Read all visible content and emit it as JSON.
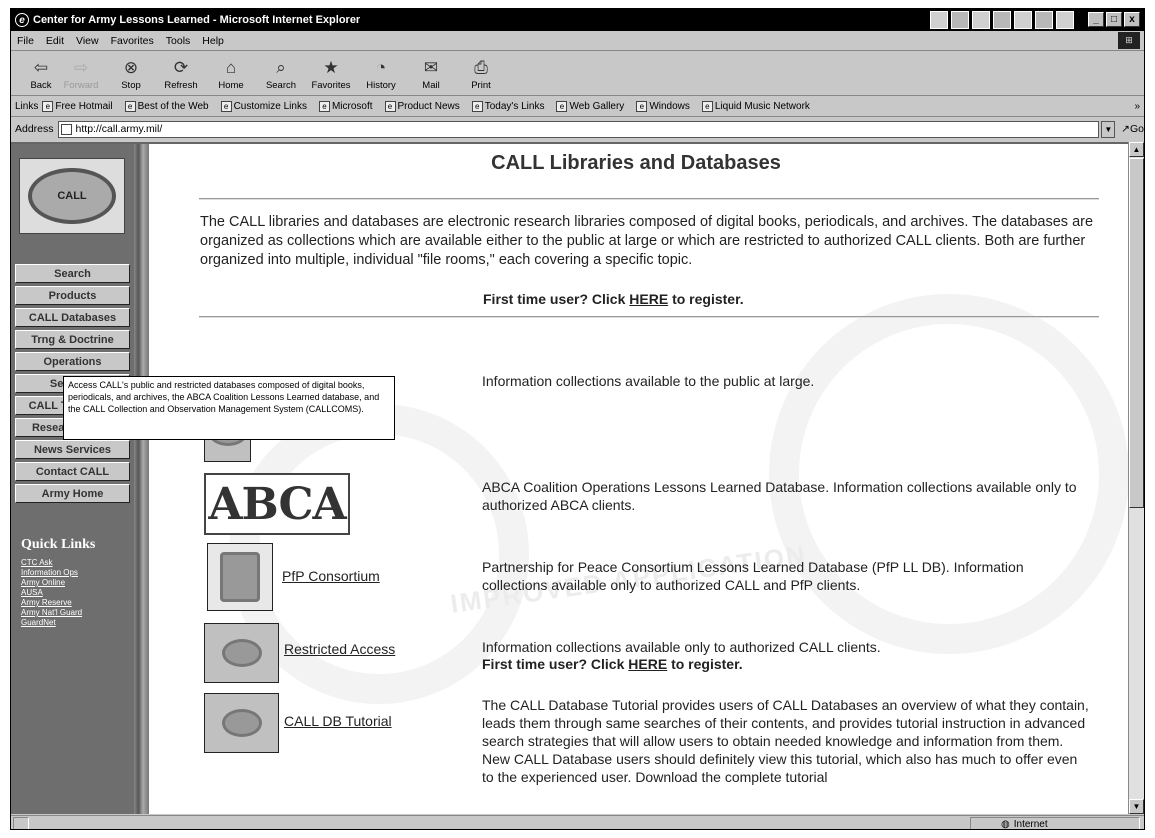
{
  "window": {
    "title": "Center for Army Lessons Learned - Microsoft Internet Explorer",
    "buttons": [
      "_",
      "□",
      "x"
    ]
  },
  "menu": [
    "File",
    "Edit",
    "View",
    "Favorites",
    "Tools",
    "Help"
  ],
  "toolbar": [
    {
      "label": "Back",
      "icon": "⇦",
      "disabled": false
    },
    {
      "label": "Forward",
      "icon": "⇨",
      "disabled": true
    },
    {
      "label": "Stop",
      "icon": "⊗",
      "disabled": false
    },
    {
      "label": "Refresh",
      "icon": "⟳",
      "disabled": false
    },
    {
      "label": "Home",
      "icon": "⌂",
      "disabled": false
    },
    {
      "label": "Search",
      "icon": "⌕",
      "disabled": false
    },
    {
      "label": "Favorites",
      "icon": "★",
      "disabled": false
    },
    {
      "label": "History",
      "icon": "◔",
      "disabled": false
    },
    {
      "label": "Mail",
      "icon": "✉",
      "disabled": false
    },
    {
      "label": "Print",
      "icon": "⎙",
      "disabled": false
    }
  ],
  "links_bar": {
    "label": "Links",
    "items": [
      "Free Hotmail",
      "Best of the Web",
      "Customize Links",
      "Microsoft",
      "Product News",
      "Today's Links",
      "Web Gallery",
      "Windows",
      "Liquid Music Network"
    ],
    "more": "»"
  },
  "address": {
    "label": "Address",
    "url": "http://call.army.mil/",
    "go": "Go"
  },
  "logo": {
    "text": "CALL"
  },
  "nav": [
    "Search",
    "Products",
    "CALL Databases",
    "Trng & Doctrine",
    "Operations",
    "Services",
    "CALL Thesaurus",
    "Research Tools",
    "News Services",
    "Contact CALL",
    "Army Home"
  ],
  "quick_links": {
    "title": "Quick Links",
    "items": [
      "CTC Ask",
      "Information Ops",
      "Army Online",
      "AUSA",
      "Army Reserve",
      "Army Nat'l Guard",
      "GuardNet"
    ]
  },
  "tooltip": "Access CALL's public and restricted databases composed of digital books, periodicals, and archives, the ABCA Coalition Lessons Learned database, and the CALL Collection and Observation Management System (CALLCOMS).",
  "page": {
    "title": "CALL Libraries and Databases",
    "intro": "The CALL libraries and databases are electronic research libraries composed of digital books, periodicals, and archives. The databases are organized as collections which are available either to the public at large or which are restricted to authorized CALL clients. Both are further organized into multiple, individual \"file rooms,\" each covering a specific topic.",
    "register_prefix": "First time user? Click ",
    "register_link": "HERE",
    "register_suffix": " to register.",
    "watermark": "IMPROVED APPLICATION",
    "entries": [
      {
        "link": "",
        "desc": "Information collections available to the public at large."
      },
      {
        "link": "",
        "image_text": "ABCA",
        "desc": "ABCA Coalition Operations Lessons Learned Database. Information collections available only to authorized ABCA clients."
      },
      {
        "link": "PfP Consortium",
        "desc": "Partnership for Peace Consortium Lessons Learned Database (PfP LL DB). Information collections available only to authorized CALL and PfP clients."
      },
      {
        "link": "Restricted Access",
        "desc": "Information collections available only to authorized CALL clients."
      },
      {
        "link": "CALL DB Tutorial",
        "desc": "The CALL Database Tutorial provides users of CALL Databases an overview of what they contain, leads them through same searches of their contents, and provides tutorial instruction in advanced search strategies that will allow users to obtain needed knowledge and information from them. New CALL Database users should definitely view this tutorial, which also has much to offer even to the experienced user. Download the complete tutorial"
      }
    ]
  },
  "status": {
    "zone": "Internet"
  }
}
